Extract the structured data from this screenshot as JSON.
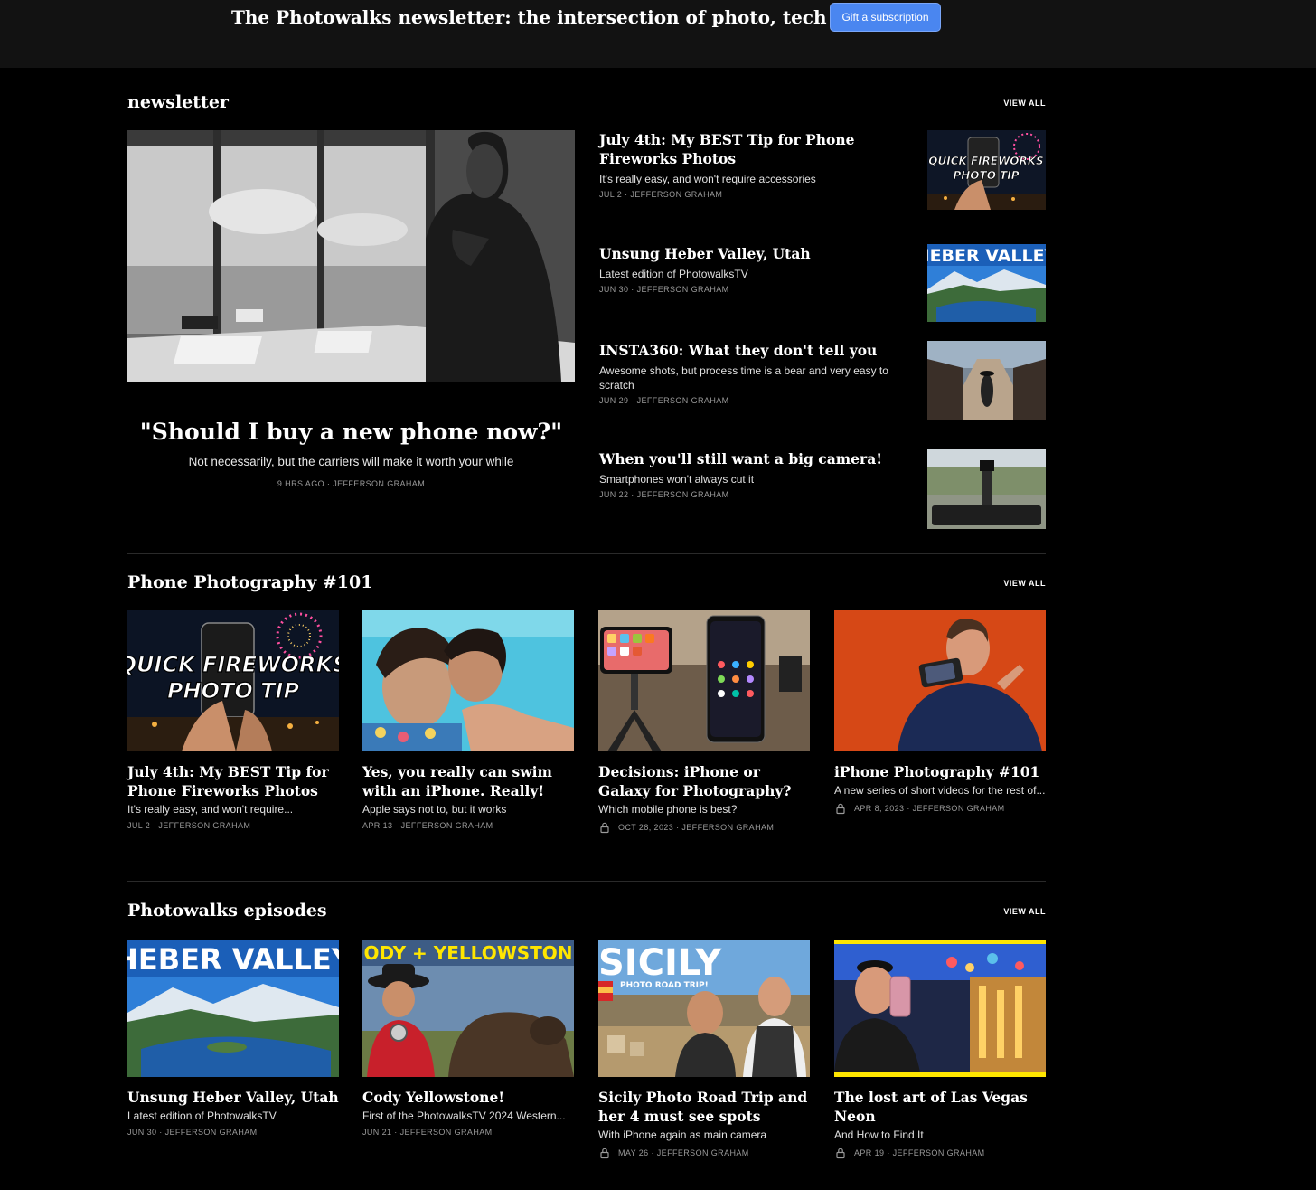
{
  "banner": {
    "text": "The Photowalks newsletter: the intersection of photo, tech & travel!",
    "gift_label": "Gift a subscription"
  },
  "sections": {
    "newsletter": {
      "title": "newsletter",
      "view_all": "VIEW ALL",
      "featured": {
        "title": "\"Should I buy a new phone now?\"",
        "subtitle": "Not necessarily, but the carriers will make it worth your while",
        "meta": "9 HRS AGO · JEFFERSON GRAHAM"
      },
      "items": [
        {
          "title": "July 4th: My BEST Tip for Phone Fireworks Photos",
          "subtitle": "It's really easy, and won't require accessories",
          "meta": "JUL 2 · JEFFERSON GRAHAM",
          "thumb_text": "QUICK FIREWORKS PHOTO TIP"
        },
        {
          "title": "Unsung Heber Valley, Utah",
          "subtitle": "Latest edition of PhotowalksTV",
          "meta": "JUN 30 · JEFFERSON GRAHAM",
          "thumb_text": "HEBER VALLEY"
        },
        {
          "title": "INSTA360: What they don't tell you",
          "subtitle": "Awesome shots, but process time is a bear and very easy to scratch",
          "meta": "JUN 29 · JEFFERSON GRAHAM"
        },
        {
          "title": "When you'll still want a big camera!",
          "subtitle": "Smartphones won't always cut it",
          "meta": "JUN 22 · JEFFERSON GRAHAM"
        }
      ]
    },
    "phone": {
      "title": "Phone Photography #101",
      "view_all": "VIEW ALL",
      "cards": [
        {
          "title": "July 4th: My BEST Tip for Phone Fireworks Photos",
          "subtitle": "It's really easy, and won't require...",
          "meta": "JUL 2 · JEFFERSON GRAHAM",
          "thumb_text_1": "QUICK FIREWORKS",
          "thumb_text_2": "PHOTO TIP"
        },
        {
          "title": "Yes, you really can swim with an iPhone. Really!",
          "subtitle": "Apple says not to, but it works",
          "meta": "APR 13 · JEFFERSON GRAHAM"
        },
        {
          "title": "Decisions: iPhone or Galaxy for Photography?",
          "subtitle": "Which mobile phone is best?",
          "meta": "OCT 28, 2023 · JEFFERSON GRAHAM"
        },
        {
          "title": "iPhone Photography #101",
          "subtitle": "A new series of short videos for the rest of...",
          "meta": "APR 8, 2023 · JEFFERSON GRAHAM"
        }
      ]
    },
    "episodes": {
      "title": "Photowalks episodes",
      "view_all": "VIEW ALL",
      "cards": [
        {
          "title": "Unsung Heber Valley, Utah",
          "subtitle": "Latest edition of PhotowalksTV",
          "meta": "JUN 30 · JEFFERSON GRAHAM",
          "thumb_text": "HEBER VALLEY"
        },
        {
          "title": "Cody Yellowstone!",
          "subtitle": "First of the PhotowalksTV 2024 Western...",
          "meta": "JUN 21 · JEFFERSON GRAHAM",
          "thumb_text": "ODY + YELLOWSTON"
        },
        {
          "title": "Sicily Photo Road Trip and her 4 must see spots",
          "subtitle": "With iPhone again as main camera",
          "meta": "MAY 26 · JEFFERSON GRAHAM",
          "thumb_text_1": "SICILY",
          "thumb_text_2": "PHOTO ROAD TRIP!"
        },
        {
          "title": "The lost art of Las Vegas Neon",
          "subtitle": "And How to Find It",
          "meta": "APR 19 · JEFFERSON GRAHAM"
        }
      ]
    }
  },
  "colors": {
    "background": "#000000",
    "banner": "#121212",
    "accent": "#4a86f0",
    "meta": "#9a9a9a"
  },
  "icons": [
    "lock-icon"
  ]
}
